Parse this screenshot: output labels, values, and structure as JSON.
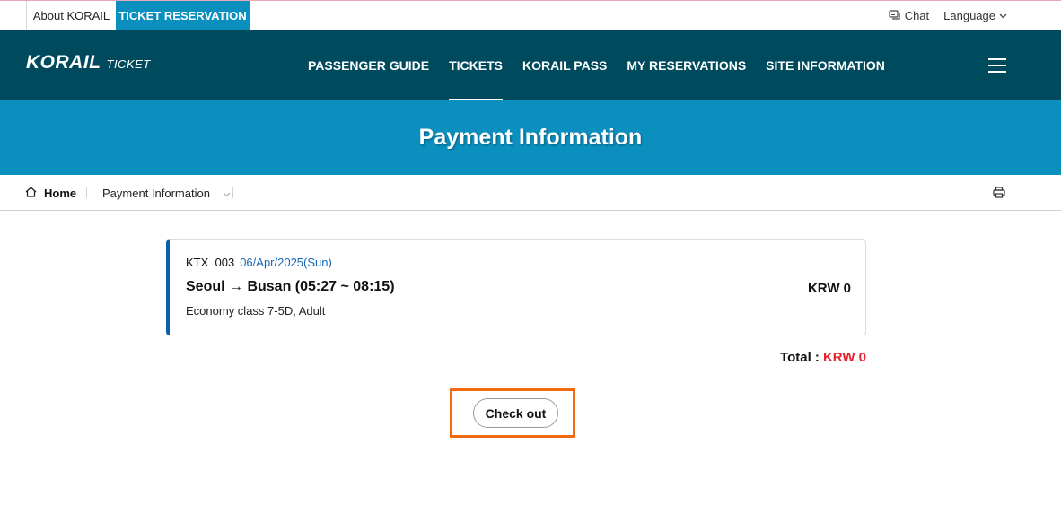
{
  "utility": {
    "about_label": "About KORAIL",
    "ticket_label": "TICKET RESERVATION",
    "chat_label": "Chat",
    "language_label": "Language"
  },
  "nav": {
    "logo_main": "KORAIL",
    "logo_sub": "TICKET",
    "items": [
      {
        "label": "PASSENGER GUIDE"
      },
      {
        "label": "TICKETS"
      },
      {
        "label": "KORAIL PASS"
      },
      {
        "label": "MY RESERVATIONS"
      },
      {
        "label": "SITE INFORMATION"
      }
    ],
    "active_index": 1
  },
  "banner": {
    "title": "Payment Information"
  },
  "breadcrumb": {
    "home": "Home",
    "current": "Payment Information"
  },
  "ticket": {
    "train": "KTX  003",
    "date": "06/Apr/2025(Sun)",
    "route": "Seoul → Busan (05:27 ~ 08:15)",
    "seat": "Economy class 7-5D, Adult",
    "price": "KRW 0"
  },
  "total": {
    "label": "Total :",
    "value": "KRW 0"
  },
  "checkout": {
    "label": "Check out"
  },
  "colors": {
    "nav_bg": "#004a5e",
    "accent": "#0a8fbf",
    "date_blue": "#1466b8",
    "total_red": "#e8222f",
    "highlight": "#f26a10"
  }
}
